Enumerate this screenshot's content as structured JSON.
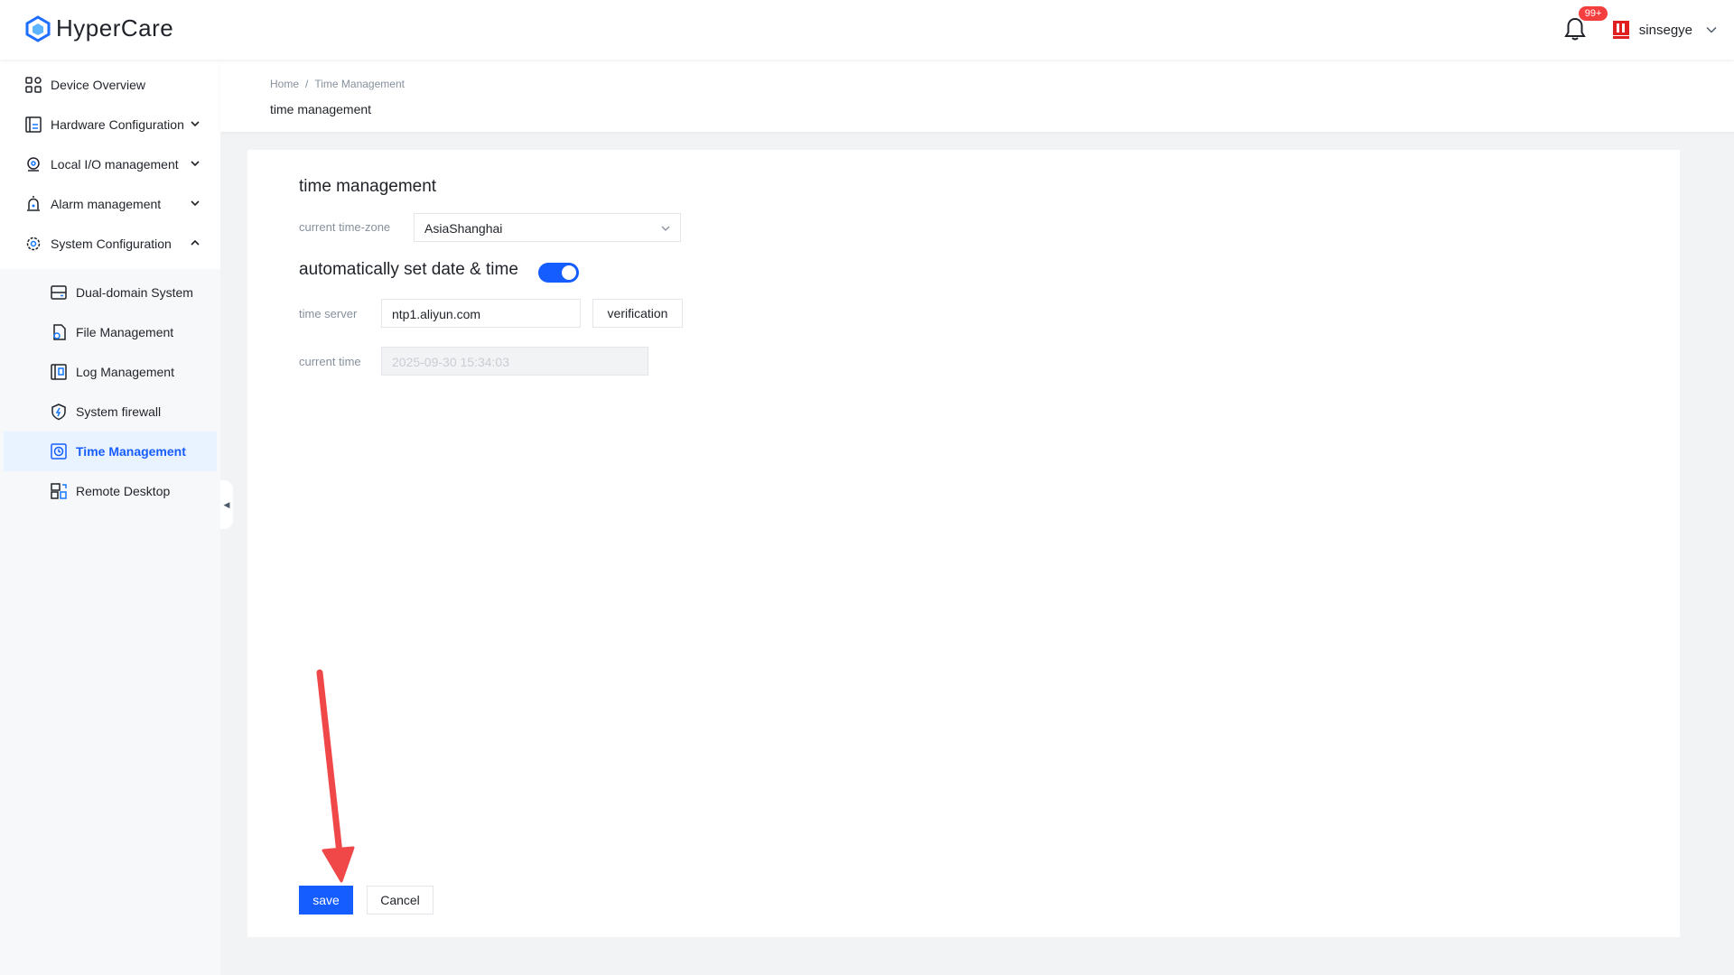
{
  "app": {
    "name": "HyperCare"
  },
  "header": {
    "notification_count": "99+",
    "user_name": "sinsegye"
  },
  "sidebar": {
    "items": [
      {
        "label": "Device Overview",
        "icon": "grid-icon"
      },
      {
        "label": "Hardware Configuration",
        "icon": "hardware-icon",
        "expand": "chevron-down"
      },
      {
        "label": "Local I/O management",
        "icon": "io-icon",
        "expand": "chevron-down"
      },
      {
        "label": "Alarm management",
        "icon": "alarm-icon",
        "expand": "chevron-down"
      },
      {
        "label": "System Configuration",
        "icon": "gear-icon",
        "expand": "chevron-up"
      }
    ],
    "sub_items": [
      {
        "label": "Dual-domain System",
        "icon": "server-icon"
      },
      {
        "label": "File Management",
        "icon": "file-gear-icon"
      },
      {
        "label": "Log Management",
        "icon": "log-icon"
      },
      {
        "label": "System firewall",
        "icon": "shield-icon"
      },
      {
        "label": "Time Management",
        "icon": "clock-icon",
        "active": true
      },
      {
        "label": "Remote Desktop",
        "icon": "remote-desktop-icon"
      }
    ]
  },
  "breadcrumb": {
    "home": "Home",
    "separator": "/",
    "current": "Time Management"
  },
  "page": {
    "title": "time management"
  },
  "form": {
    "section_title": "time management",
    "timezone_label": "current time-zone",
    "timezone_value": "AsiaShanghai",
    "auto_label": "automatically set date & time",
    "auto_enabled": true,
    "server_label": "time server",
    "server_value": "ntp1.aliyun.com",
    "verify_label": "verification",
    "current_time_label": "current time",
    "current_time_value": "2025-09-30 15:34:03"
  },
  "actions": {
    "save_label": "save",
    "cancel_label": "Cancel"
  },
  "colors": {
    "primary": "#165dff",
    "badge": "#f53f3f",
    "annotation_arrow": "#f04848"
  }
}
